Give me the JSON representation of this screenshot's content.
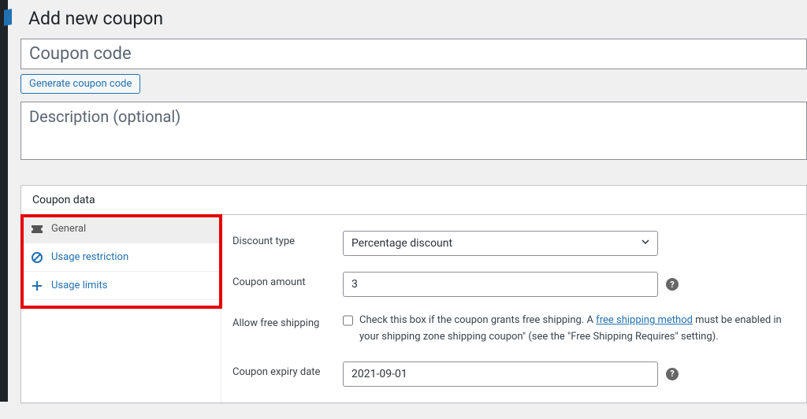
{
  "page_title": "Add new coupon",
  "coupon_code": {
    "value": "",
    "placeholder": "Coupon code"
  },
  "generate_btn": "Generate coupon code",
  "description": {
    "value": "",
    "placeholder": "Description (optional)"
  },
  "metabox_title": "Coupon data",
  "tabs": {
    "general": "General",
    "usage_restriction": "Usage restriction",
    "usage_limits": "Usage limits"
  },
  "fields": {
    "discount_type": {
      "label": "Discount type",
      "value": "Percentage discount"
    },
    "coupon_amount": {
      "label": "Coupon amount",
      "value": "3"
    },
    "free_shipping": {
      "label": "Allow free shipping",
      "checked": false,
      "text_before": "Check this box if the coupon grants free shipping. A ",
      "link_text": "free shipping method",
      "text_after": " must be enabled in your shipping zone shipping coupon\" (see the \"Free Shipping Requires\" setting)."
    },
    "expiry": {
      "label": "Coupon expiry date",
      "value": "2021-09-01"
    }
  }
}
